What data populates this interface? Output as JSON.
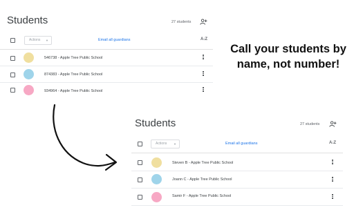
{
  "colors": {
    "accent": "#1a73e8",
    "avatar_yellow": "#f0df9f",
    "avatar_blue": "#9fd4ea",
    "avatar_pink": "#f7a8c4"
  },
  "before": {
    "title": "Students",
    "count": "27 students",
    "actions_label": "Actions",
    "email_label": "Email all guardians",
    "rows": [
      {
        "text": "546738 - Apple Tree Public School",
        "avatar_color": "#f0df9f"
      },
      {
        "text": "874383 - Apple Tree Public School",
        "avatar_color": "#9fd4ea"
      },
      {
        "text": "934964 - Apple Tree Public School",
        "avatar_color": "#f7a8c4"
      }
    ]
  },
  "after": {
    "title": "Students",
    "count": "27 students",
    "actions_label": "Actions",
    "email_label": "Email all guardians",
    "rows": [
      {
        "text": "Steven B - Apple Tree Public School",
        "avatar_color": "#f0df9f"
      },
      {
        "text": "Joann C - Apple Tree Public School",
        "avatar_color": "#9fd4ea"
      },
      {
        "text": "Samir F - Apple Tree Public School",
        "avatar_color": "#f7a8c4"
      }
    ]
  },
  "headline": "Call your students by name, not number!",
  "icons": [
    "add-person-icon",
    "sort-az-icon",
    "more-vert-icon",
    "chevron-down-icon",
    "curved-arrow-icon"
  ]
}
